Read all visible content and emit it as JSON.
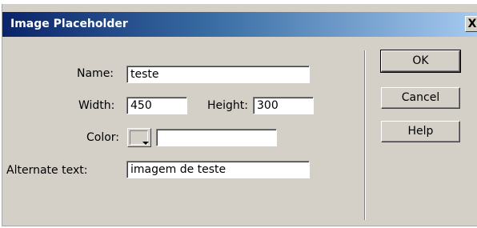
{
  "dialog": {
    "title": "Image Placeholder",
    "close_label": "X"
  },
  "fields": {
    "name": {
      "label": "Name:",
      "value": "teste"
    },
    "width": {
      "label": "Width:",
      "value": "450"
    },
    "height": {
      "label": "Height:",
      "value": "300"
    },
    "color": {
      "label": "Color:",
      "value": ""
    },
    "alt": {
      "label": "Alternate text:",
      "value": "imagem de teste"
    }
  },
  "buttons": {
    "ok": "OK",
    "cancel": "Cancel",
    "help": "Help"
  },
  "colors": {
    "title_gradient_start": "#0a246a",
    "title_gradient_end": "#a6caf0",
    "dialog_bg": "#d4d0c8"
  }
}
